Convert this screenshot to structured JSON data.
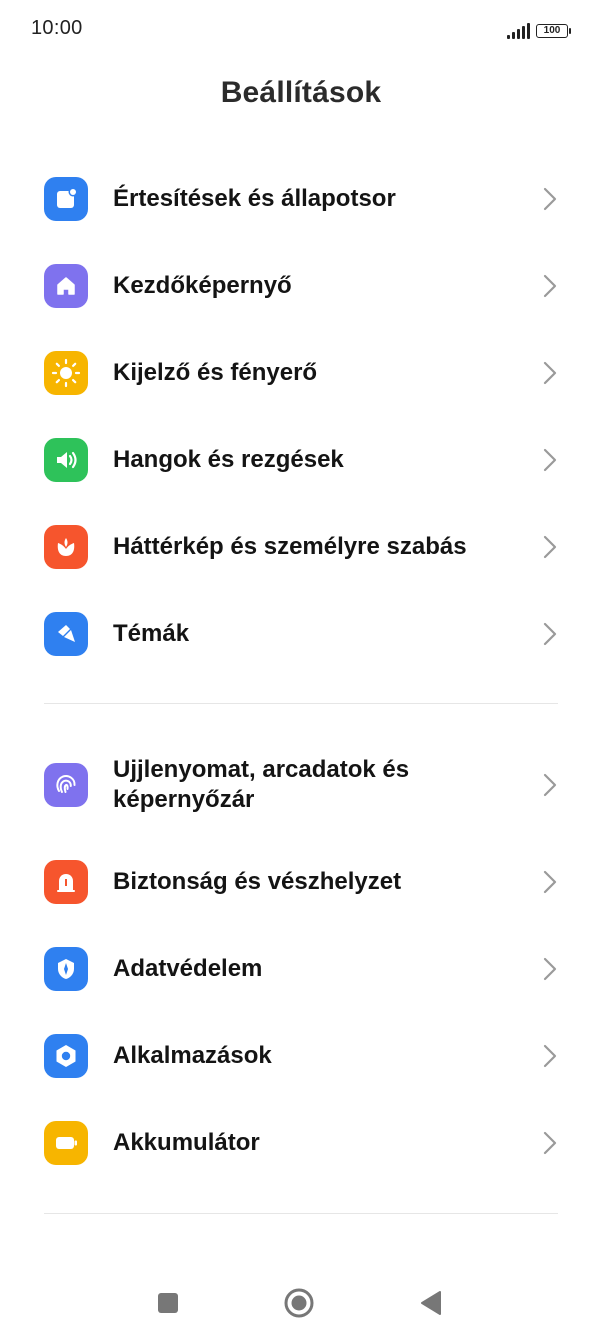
{
  "status": {
    "time": "10:00",
    "battery": "100"
  },
  "header": {
    "title": "Beállítások"
  },
  "groups": [
    {
      "items": [
        {
          "label": "Értesítések és állapotsor",
          "icon": "notification-icon",
          "color": "#2f80f0"
        },
        {
          "label": "Kezdőképernyő",
          "icon": "home-icon",
          "color": "#7f72ee"
        },
        {
          "label": "Kijelző és fényerő",
          "icon": "sun-icon",
          "color": "#f7b500"
        },
        {
          "label": "Hangok és rezgések",
          "icon": "speaker-icon",
          "color": "#2ec25a"
        },
        {
          "label": "Háttérkép és személyre szabás",
          "icon": "flower-icon",
          "color": "#f6552d"
        },
        {
          "label": "Témák",
          "icon": "brush-icon",
          "color": "#2f80f0"
        }
      ]
    },
    {
      "items": [
        {
          "label": "Ujjlenyomat, arcadatok és képernyőzár",
          "icon": "fingerprint-icon",
          "color": "#7f72ee"
        },
        {
          "label": "Biztonság és vészhelyzet",
          "icon": "emergency-icon",
          "color": "#f6552d"
        },
        {
          "label": "Adatvédelem",
          "icon": "privacy-icon",
          "color": "#2f80f0"
        },
        {
          "label": "Alkalmazások",
          "icon": "apps-gear-icon",
          "color": "#2f80f0"
        },
        {
          "label": "Akkumulátor",
          "icon": "battery-icon",
          "color": "#f7b500"
        }
      ]
    }
  ],
  "navbar": {
    "buttons": [
      "recents-button",
      "home-button",
      "back-button"
    ]
  }
}
